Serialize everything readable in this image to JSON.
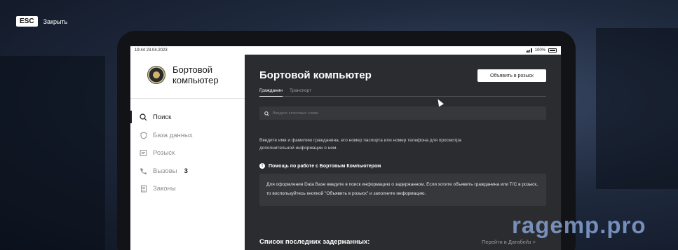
{
  "overlay": {
    "esc_key": "ESC",
    "esc_label": "Закрыть"
  },
  "statusbar": {
    "time": "19:44 23.04.2023",
    "battery": "100%"
  },
  "sidebar": {
    "brand_title": "Бортовой компьютер",
    "items": [
      {
        "label": "Поиск",
        "icon": "search-icon",
        "active": true
      },
      {
        "label": "База данных",
        "icon": "shield-icon"
      },
      {
        "label": "Розыск",
        "icon": "document-icon"
      },
      {
        "label": "Вызовы",
        "icon": "phone-icon",
        "badge": "3"
      },
      {
        "label": "Законы",
        "icon": "law-book-icon"
      }
    ]
  },
  "main": {
    "title": "Бортовой компьютер",
    "report_button": "Объявить в розыск",
    "tabs": [
      {
        "label": "Гражданин",
        "active": true
      },
      {
        "label": "Транспорт"
      }
    ],
    "search_placeholder": "Введите ключевые слова",
    "hint": "Введите имя и фамилию гражданина, его номер паспорта или номер телефона для просмотра дополнительной информации о нем.",
    "help_title": "Помощь по работе с Бортовым Компьютером",
    "help_text": "Для оформления Data Base введите в поиск информацию о задержанном. Если хотите объявить гражданина или Т/С в розыск, то воспользуйтесь кнопкой \"Объявить в розыск\" и заполните информацию.",
    "recent_title": "Список последних задержанных:",
    "recent_link": "Перейти в Датабейз >"
  },
  "watermark": "ragemp.pro"
}
